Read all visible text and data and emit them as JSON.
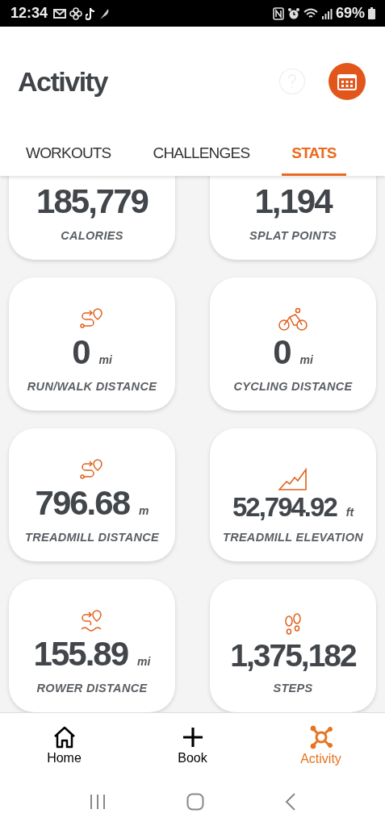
{
  "status_bar": {
    "time": "12:34",
    "battery": "69%"
  },
  "header": {
    "title": "Activity"
  },
  "tabs": [
    {
      "label": "WORKOUTS",
      "selected": false
    },
    {
      "label": "CHALLENGES",
      "selected": false
    },
    {
      "label": "STATS",
      "selected": true
    }
  ],
  "stats": [
    {
      "value": "185,779",
      "label": "CALORIES"
    },
    {
      "value": "1,194",
      "label": "SPLAT POINTS"
    },
    {
      "kind": "route",
      "value": "0",
      "unit": "mi",
      "label": "RUN/WALK DISTANCE"
    },
    {
      "kind": "bike",
      "value": "0",
      "unit": "mi",
      "label": "CYCLING DISTANCE"
    },
    {
      "kind": "route",
      "value": "796.68",
      "unit": "m",
      "label": "TREADMILL DISTANCE"
    },
    {
      "kind": "elevation",
      "value": "52,794.92",
      "unit": "ft",
      "label": "TREADMILL ELEVATION"
    },
    {
      "kind": "rower",
      "value": "155.89",
      "unit": "mi",
      "label": "ROWER DISTANCE"
    },
    {
      "kind": "steps",
      "value": "1,375,182",
      "label": "STEPS"
    }
  ],
  "bottom_nav": [
    {
      "kind": "home",
      "label": "Home",
      "selected": false
    },
    {
      "kind": "book",
      "label": "Book",
      "selected": false
    },
    {
      "kind": "activity",
      "label": "Activity",
      "selected": true
    }
  ]
}
